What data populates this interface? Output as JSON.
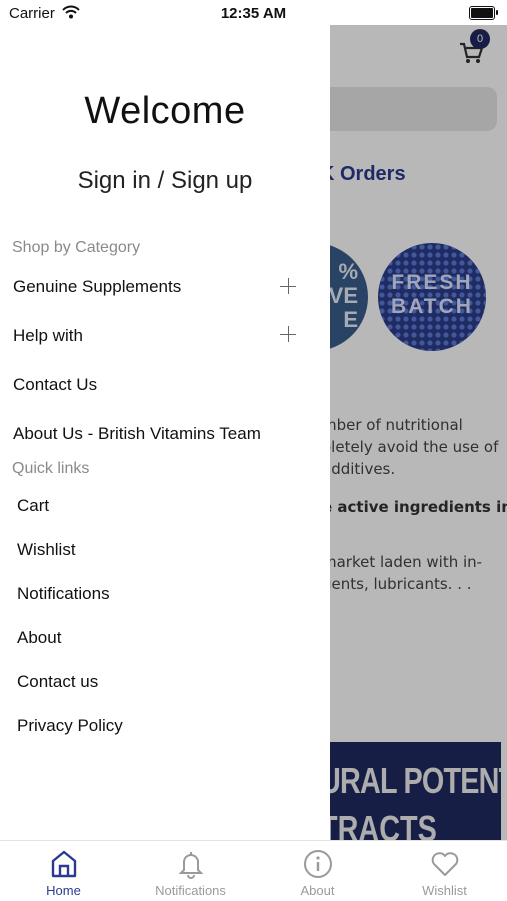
{
  "status_bar": {
    "carrier": "Carrier",
    "time": "12:35 AM"
  },
  "drawer": {
    "welcome": "Welcome",
    "sign_in": "Sign in / Sign up",
    "shop_title": "Shop by Category",
    "categories": [
      {
        "label": "Genuine Supplements",
        "expandable": true
      },
      {
        "label": "Help with",
        "expandable": true
      },
      {
        "label": "Contact Us",
        "expandable": false
      },
      {
        "label": "About Us - British Vitamins Team",
        "expandable": false
      }
    ],
    "quick_title": "Quick links",
    "quick_links": [
      "Cart",
      "Wishlist",
      "Notifications",
      "About",
      "Contact us",
      "Privacy Policy"
    ]
  },
  "background": {
    "cart_count": "0",
    "orders_text": "K Orders",
    "circle1_lines": [
      "%",
      "VE",
      "E"
    ],
    "circle2_lines": [
      "FRESH",
      "BATCH"
    ],
    "para_lines": [
      "mber of nutritional",
      "oletely avoid the use of",
      "additives."
    ],
    "bold_line": "e active ingredients in",
    "para2_lines": [
      "market laden with in-",
      "gents, lubricants. . ."
    ],
    "banner_lines": [
      "URAL POTENT",
      "TRACTS"
    ]
  },
  "tabs": [
    {
      "label": "Home",
      "icon": "home-icon",
      "active": true
    },
    {
      "label": "Notifications",
      "icon": "bell-icon",
      "active": false
    },
    {
      "label": "About",
      "icon": "info-icon",
      "active": false
    },
    {
      "label": "Wishlist",
      "icon": "heart-icon",
      "active": false
    }
  ],
  "colors": {
    "accent": "#2b3a8f",
    "banner": "#1f2a60",
    "inactive": "#9a9a9a"
  }
}
